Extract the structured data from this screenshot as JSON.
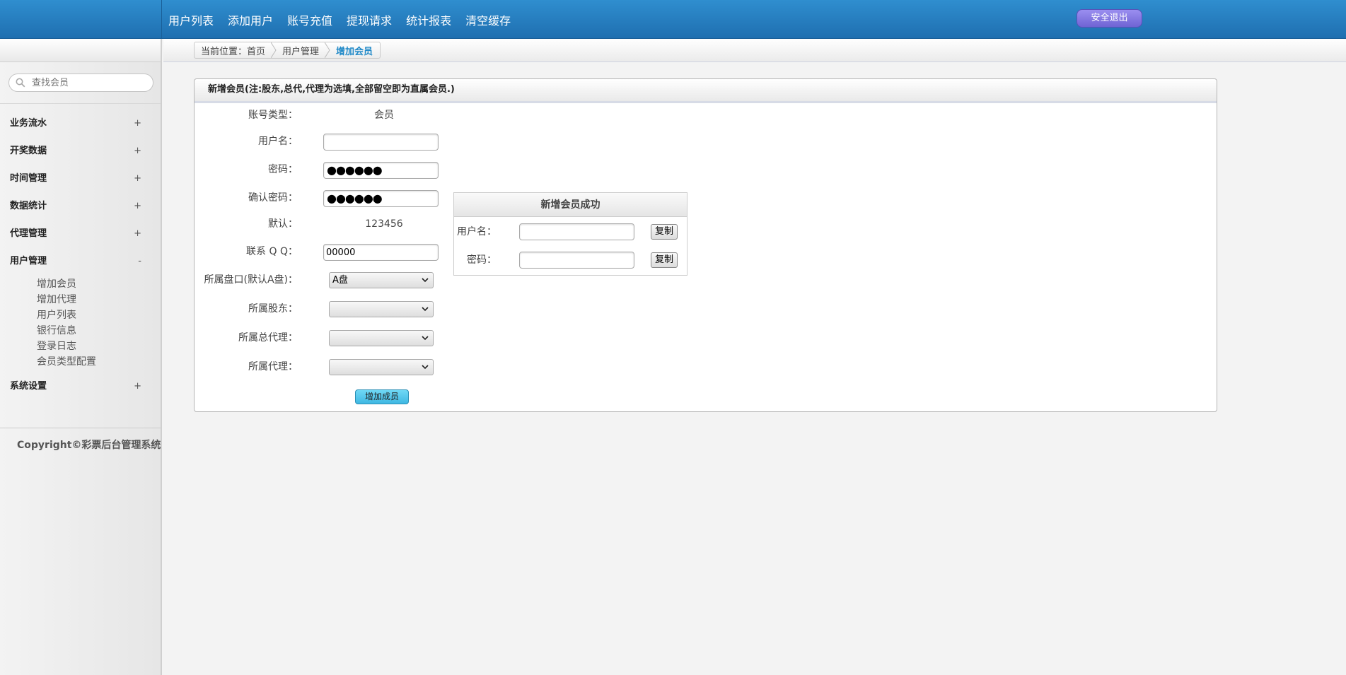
{
  "topnav": {
    "items": [
      "用户列表",
      "添加用户",
      "账号充值",
      "提现请求",
      "统计报表",
      "清空缓存"
    ],
    "logout_label": "安全退出"
  },
  "sidebar": {
    "search_placeholder": "查找会员",
    "menus": [
      {
        "label": "业务流水",
        "toggle": "+"
      },
      {
        "label": "开奖数据",
        "toggle": "+"
      },
      {
        "label": "时间管理",
        "toggle": "+"
      },
      {
        "label": "数据统计",
        "toggle": "+"
      },
      {
        "label": "代理管理",
        "toggle": "+"
      },
      {
        "label": "用户管理",
        "toggle": "-"
      }
    ],
    "submenu": [
      "增加会员",
      "增加代理",
      "用户列表",
      "银行信息",
      "登录日志",
      "会员类型配置"
    ],
    "last_menu": {
      "label": "系统设置",
      "toggle": "+"
    },
    "copyright": "Copyright©彩票后台管理系统"
  },
  "breadcrumb": {
    "prefix": "当前位置：",
    "home": "首页",
    "section": "用户管理",
    "current": "增加会员"
  },
  "form": {
    "title": "新增会员(注:股东,总代,代理为选填,全部留空即为直属会员.)",
    "account_type_label": "账号类型：",
    "account_type_value": "会员",
    "username_label": "用户名：",
    "username_value": "",
    "password_label": "密码：",
    "password_dots": "●●●●●●",
    "confirm_label": "确认密码：",
    "confirm_dots": "●●●●●●",
    "default_label": "默认：",
    "default_value": "123456",
    "qq_label": "联系 Q Q：",
    "qq_value": "00000",
    "pan_label": "所属盘口(默认A盘)：",
    "pan_value": "A盘",
    "shareholder_label": "所属股东：",
    "shareholder_value": "",
    "general_agent_label": "所属总代理：",
    "general_agent_value": "",
    "agent_label": "所属代理：",
    "agent_value": "",
    "submit_label": "增加成员"
  },
  "result": {
    "title": "新增会员成功",
    "username_label": "用户名：",
    "password_label": "密码：",
    "copy_label": "复制"
  }
}
